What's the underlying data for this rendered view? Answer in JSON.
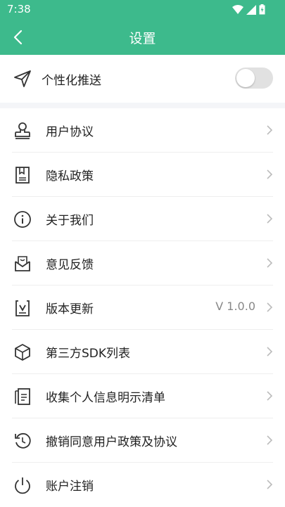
{
  "status": {
    "time": "7:38"
  },
  "header": {
    "title": "设置"
  },
  "push": {
    "label": "个性化推送",
    "enabled": false
  },
  "items": [
    {
      "label": "用户协议",
      "icon": "user-stamp-icon",
      "value": ""
    },
    {
      "label": "隐私政策",
      "icon": "bookmark-doc-icon",
      "value": ""
    },
    {
      "label": "关于我们",
      "icon": "info-icon",
      "value": ""
    },
    {
      "label": "意见反馈",
      "icon": "feedback-mail-icon",
      "value": ""
    },
    {
      "label": "版本更新",
      "icon": "update-box-icon",
      "value": "V 1.0.0"
    },
    {
      "label": "第三方SDK列表",
      "icon": "cube-icon",
      "value": ""
    },
    {
      "label": "收集个人信息明示清单",
      "icon": "documents-list-icon",
      "value": ""
    },
    {
      "label": "撤销同意用户政策及协议",
      "icon": "revoke-rotate-icon",
      "value": ""
    },
    {
      "label": "账户注销",
      "icon": "power-icon",
      "value": ""
    }
  ]
}
